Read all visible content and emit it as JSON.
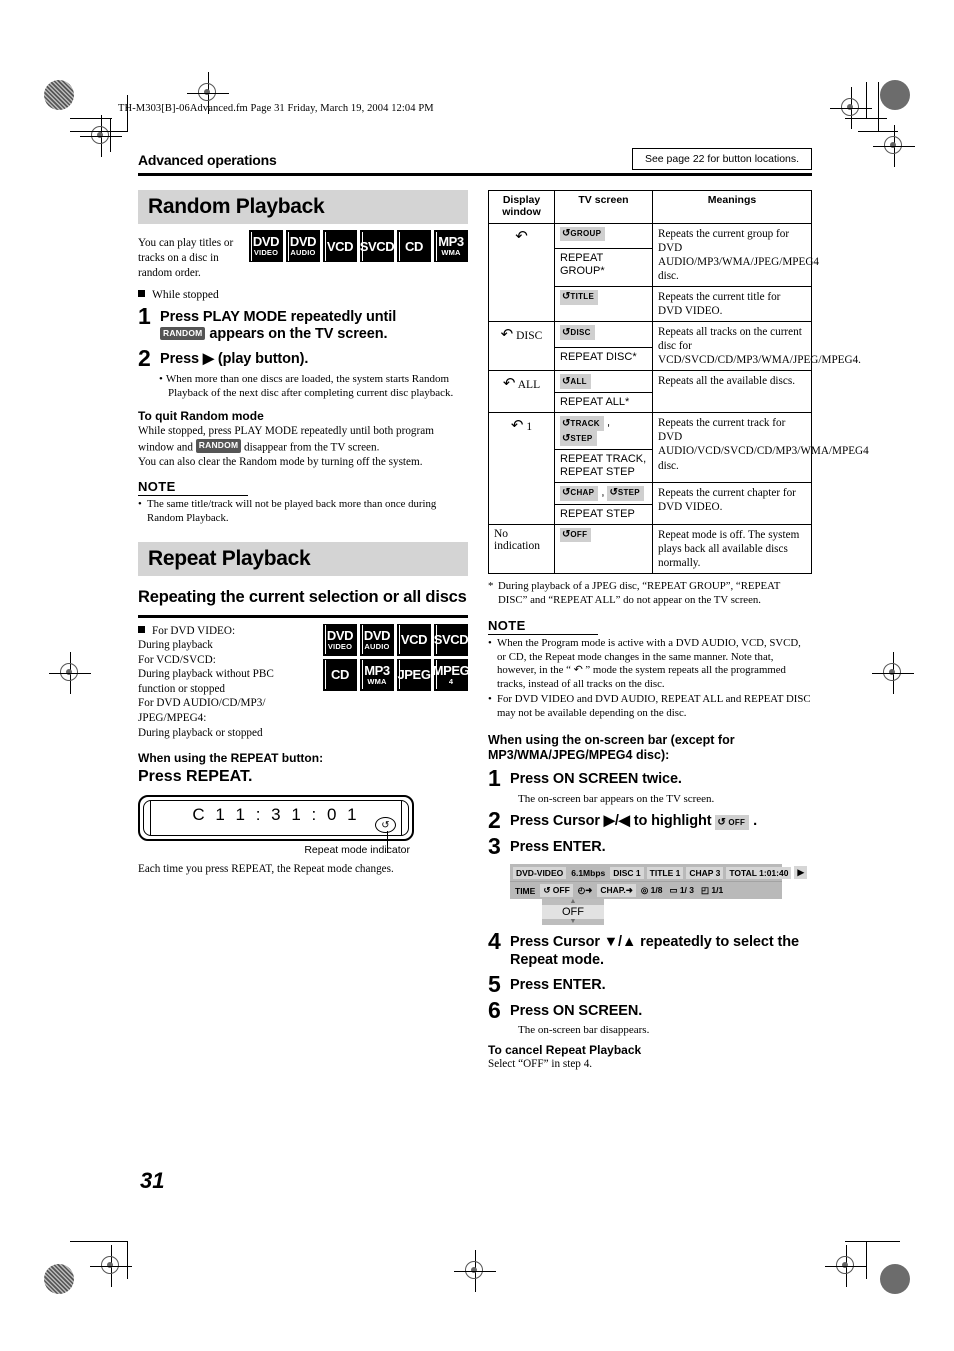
{
  "header": {
    "file_line": "TH-M303[B]-06Advanced.fm  Page 31  Friday, March 19, 2004  12:04 PM",
    "section_title": "Advanced operations",
    "see_page_note": "See page 22 for button locations."
  },
  "page_number": "31",
  "left_column": {
    "random": {
      "banner": "Random Playback",
      "lead": "You can play titles or tracks on a disc in random order.",
      "badges": [
        {
          "line1": "DVD",
          "line2": "VIDEO"
        },
        {
          "line1": "DVD",
          "line2": "AUDIO"
        },
        {
          "line1": "VCD",
          "line2": ""
        },
        {
          "line1": "SVCD",
          "line2": ""
        },
        {
          "line1": "CD",
          "line2": ""
        },
        {
          "line1": "MP3",
          "line2": "WMA"
        }
      ],
      "condition": "While stopped",
      "steps": [
        {
          "num": "1",
          "text_a": "Press PLAY MODE repeatedly until",
          "tag": "RANDOM",
          "text_b": "appears on the TV screen.",
          "sub": ""
        },
        {
          "num": "2",
          "text_a": "Press ▶ (play button).",
          "tag": "",
          "text_b": "",
          "sub": "When more than one discs are loaded, the system starts Random Playback of the next disc after completing current disc playback."
        }
      ],
      "quit_heading": "To quit Random mode",
      "quit_text_a": "While stopped, press PLAY MODE repeatedly until both program window and",
      "quit_tag": "RANDOM",
      "quit_text_b": "disappear from the TV screen.",
      "quit_text_c": "You can also clear the Random mode by turning off the system.",
      "note_heading": "NOTE",
      "note_items": [
        "The same title/track will not be played back more than once during Random Playback."
      ]
    },
    "repeat": {
      "banner": "Repeat Playback",
      "subheading": "Repeating the current selection or all discs",
      "conditions": [
        "For DVD VIDEO:",
        "During playback",
        "For VCD/SVCD:",
        "During playback without PBC",
        "function or stopped",
        "For DVD AUDIO/CD/MP3/",
        "JPEG/MPEG4:",
        "During playback or stopped"
      ],
      "badges": [
        {
          "line1": "DVD",
          "line2": "VIDEO"
        },
        {
          "line1": "DVD",
          "line2": "AUDIO"
        },
        {
          "line1": "VCD",
          "line2": ""
        },
        {
          "line1": "SVCD",
          "line2": ""
        },
        {
          "line1": "CD",
          "line2": ""
        },
        {
          "line1": "MP3",
          "line2": "WMA"
        },
        {
          "line1": "JPEG",
          "line2": ""
        },
        {
          "line1": "MPEG",
          "line2": "4"
        }
      ],
      "button_heading": "When using the REPEAT button:",
      "press_repeat": "Press REPEAT.",
      "display_value": "C  1   1 : 3 1 : 0 1",
      "display_indicator_symbol": "↺",
      "callout_label": "Repeat mode indicator",
      "closing_text": "Each time you press REPEAT, the Repeat mode changes."
    }
  },
  "right_column": {
    "table": {
      "headers": [
        "Display window",
        "TV screen",
        "Meanings"
      ],
      "rows": [
        {
          "display": "↶",
          "display_suffix": "",
          "groups": [
            {
              "tv_lines": [
                {
                  "kind": "osd",
                  "glyph": "↺",
                  "label": "GROUP"
                },
                {
                  "kind": "plain",
                  "text": "REPEAT GROUP*"
                }
              ],
              "meaning": "Repeats the current group for DVD AUDIO/MP3/WMA/JPEG/MPEG4 disc."
            },
            {
              "tv_lines": [
                {
                  "kind": "osd",
                  "glyph": "↺",
                  "label": "TITLE"
                }
              ],
              "meaning": "Repeats the current title for DVD VIDEO."
            }
          ]
        },
        {
          "display": "↶",
          "display_suffix": "DISC",
          "groups": [
            {
              "tv_lines": [
                {
                  "kind": "osd",
                  "glyph": "↺",
                  "label": "DISC"
                },
                {
                  "kind": "plain",
                  "text": "REPEAT DISC*"
                }
              ],
              "meaning": "Repeats all tracks on the current disc for VCD/SVCD/CD/MP3/WMA/JPEG/MPEG4."
            }
          ]
        },
        {
          "display": "↶",
          "display_suffix": "ALL",
          "groups": [
            {
              "tv_lines": [
                {
                  "kind": "osd",
                  "glyph": "↺",
                  "label": "ALL"
                },
                {
                  "kind": "plain",
                  "text": "REPEAT ALL*"
                }
              ],
              "meaning": "Repeats all the available discs."
            }
          ]
        },
        {
          "display": "↶",
          "display_suffix": "1",
          "groups": [
            {
              "tv_lines": [
                {
                  "kind": "osd2",
                  "glyph": "↺",
                  "label": "TRACK",
                  "glyph2": "↺",
                  "label2": "STEP"
                },
                {
                  "kind": "plain",
                  "text": "REPEAT TRACK, REPEAT STEP"
                }
              ],
              "meaning": "Repeats the current track for DVD AUDIO/VCD/SVCD/CD/MP3/WMA/MPEG4 disc."
            },
            {
              "tv_lines": [
                {
                  "kind": "osd2",
                  "glyph": "↺",
                  "label": "CHAP",
                  "glyph2": "↺",
                  "label2": "STEP"
                },
                {
                  "kind": "plain",
                  "text": "REPEAT STEP"
                }
              ],
              "meaning": "Repeats the current chapter for DVD VIDEO."
            }
          ]
        },
        {
          "display": "No indication",
          "display_suffix": "",
          "groups": [
            {
              "tv_lines": [
                {
                  "kind": "osd",
                  "glyph": "↺",
                  "label": "OFF"
                }
              ],
              "meaning": "Repeat mode is off. The system plays back all available discs normally."
            }
          ]
        }
      ]
    },
    "asterisk_note": "During playback of a JPEG disc, “REPEAT GROUP”, “REPEAT DISC” and “REPEAT ALL” do not appear on the TV screen.",
    "note_heading": "NOTE",
    "note_items": [
      "When the Program mode is active with a DVD AUDIO, VCD, SVCD, or CD, the Repeat mode changes in the same manner. Note that, however, in the “ ↶ ” mode the system repeats all the programmed tracks, instead of all tracks on the disc.",
      "For DVD VIDEO and DVD AUDIO, REPEAT ALL and REPEAT DISC may not be available depending on the disc."
    ],
    "osb_heading": "When using the on-screen bar (except for MP3/WMA/JPEG/MPEG4 disc):",
    "steps": [
      {
        "num": "1",
        "text_a": "Press ON SCREEN twice.",
        "tag": "",
        "text_b": "",
        "sub": "The on-screen bar appears on the TV screen."
      },
      {
        "num": "2",
        "text_a": "Press Cursor ▶/◀ to highlight",
        "tag": "OFF",
        "text_b": ".",
        "sub": ""
      },
      {
        "num": "3",
        "text_a": "Press ENTER.",
        "tag": "",
        "text_b": "",
        "sub": ""
      },
      {
        "num": "4",
        "text_a": "Press Cursor ▼/▲ repeatedly to select the Repeat mode.",
        "tag": "",
        "text_b": "",
        "sub": ""
      },
      {
        "num": "5",
        "text_a": "Press ENTER.",
        "tag": "",
        "text_b": "",
        "sub": ""
      },
      {
        "num": "6",
        "text_a": "Press ON SCREEN.",
        "tag": "",
        "text_b": "",
        "sub": "The on-screen bar disappears."
      }
    ],
    "osd_bar": {
      "row1": [
        {
          "type": "cell",
          "text": "DVD-VIDEO"
        },
        {
          "type": "plain",
          "text": "6.1Mbps"
        },
        {
          "type": "cell",
          "text": "DISC  1"
        },
        {
          "type": "cell",
          "text": "TITLE  1"
        },
        {
          "type": "cell",
          "text": "CHAP  3"
        },
        {
          "type": "cell",
          "text": "TOTAL   1:01:40"
        },
        {
          "type": "cell",
          "text": "▶"
        }
      ],
      "row2": [
        {
          "type": "plain",
          "text": "TIME"
        },
        {
          "type": "cell",
          "text": "↺ OFF"
        },
        {
          "type": "plain",
          "text": "◴➜"
        },
        {
          "type": "cell",
          "text": "CHAP.➜"
        },
        {
          "type": "plain",
          "text": "◎ 1/8"
        },
        {
          "type": "plain",
          "text": "▭ 1/ 3"
        },
        {
          "type": "plain",
          "text": "◰ 1/1"
        }
      ],
      "selector_value": "OFF"
    },
    "cancel_heading": "To cancel Repeat Playback",
    "cancel_text": "Select “OFF” in step 4."
  }
}
